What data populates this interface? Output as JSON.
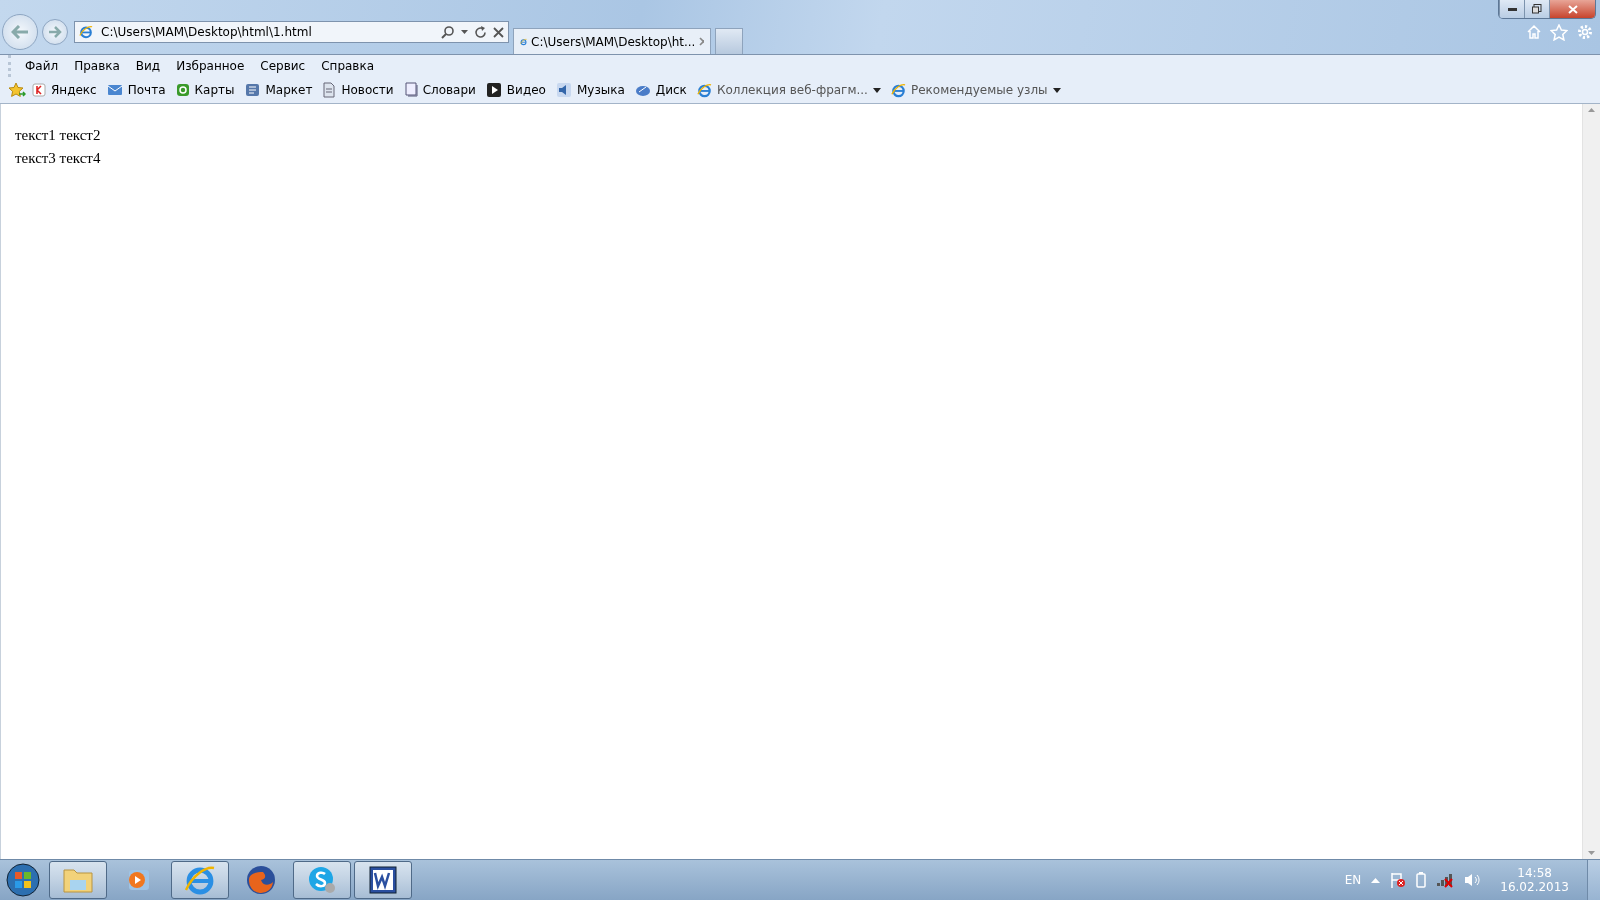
{
  "address_bar": {
    "value": "C:\\Users\\MAM\\Desktop\\html\\1.html"
  },
  "tabs": [
    {
      "label": "C:\\Users\\MAM\\Desktop\\ht...",
      "selected": true
    }
  ],
  "menu_bar": [
    "Файл",
    "Правка",
    "Вид",
    "Избранное",
    "Сервис",
    "Справка"
  ],
  "favorites_bar": [
    {
      "label": "Яндекс",
      "has_menu": false
    },
    {
      "label": "Почта",
      "has_menu": false
    },
    {
      "label": "Карты",
      "has_menu": false
    },
    {
      "label": "Маркет",
      "has_menu": false
    },
    {
      "label": "Новости",
      "has_menu": false
    },
    {
      "label": "Словари",
      "has_menu": false
    },
    {
      "label": "Видео",
      "has_menu": false
    },
    {
      "label": "Музыка",
      "has_menu": false
    },
    {
      "label": "Диск",
      "has_menu": false
    },
    {
      "label": "Коллекция веб-фрагм...",
      "has_menu": true
    },
    {
      "label": "Рекомендуемые узлы",
      "has_menu": true
    }
  ],
  "page_content": [
    "текст1 текст2",
    "текст3 текст4"
  ],
  "taskbar": {
    "apps": [
      {
        "active": true
      },
      {
        "active": false
      },
      {
        "active": true
      },
      {
        "active": false
      },
      {
        "active": true
      },
      {
        "active": true
      }
    ],
    "language": "EN",
    "time": "14:58",
    "date": "16.02.2013"
  }
}
